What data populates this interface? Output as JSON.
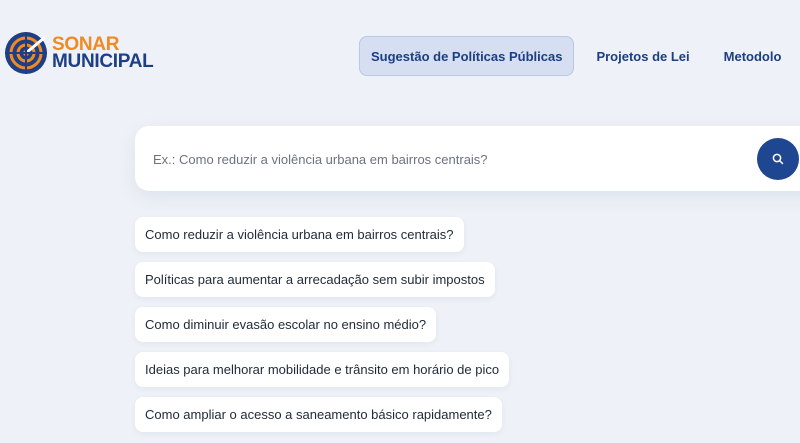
{
  "brand": {
    "line1": "SONAR",
    "line2": "MUNICIPAL",
    "icon": "radar-icon"
  },
  "nav": [
    {
      "label": "Sugestão de Políticas Públicas",
      "active": true
    },
    {
      "label": "Projetos de Lei",
      "active": false
    },
    {
      "label": "Metodolo",
      "active": false
    }
  ],
  "search": {
    "placeholder": "Ex.: Como reduzir a violência urbana em bairros centrais?",
    "value": "",
    "button_icon": "search-icon"
  },
  "suggestions": [
    "Como reduzir a violência urbana em bairros centrais?",
    "Políticas para aumentar a arrecadação sem subir impostos",
    "Como diminuir evasão escolar no ensino médio?",
    "Ideias para melhorar mobilidade e trânsito em horário de pico",
    "Como ampliar o acesso a saneamento básico rapidamente?"
  ],
  "colors": {
    "brand_orange": "#f08a24",
    "brand_blue": "#1e3f86",
    "button": "#1f4690",
    "background": "#eef1f7"
  }
}
